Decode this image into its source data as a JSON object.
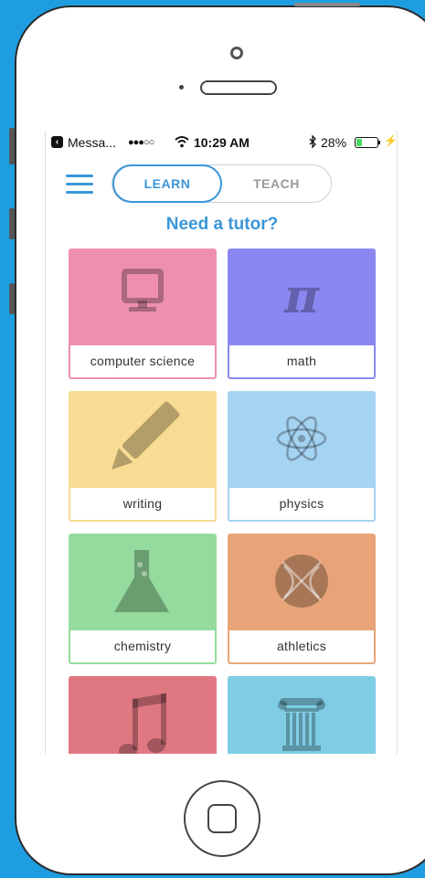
{
  "status_bar": {
    "back_app": "Messa...",
    "signal": "●●●○○",
    "time": "10:29 AM",
    "battery_percent": "28%",
    "battery_level": 0.28
  },
  "header": {
    "tabs": [
      {
        "label": "LEARN",
        "selected": true
      },
      {
        "label": "TEACH",
        "selected": false
      }
    ],
    "heading": "Need a tutor?"
  },
  "subjects": [
    {
      "label": "computer science",
      "icon": "computer-icon",
      "color": "#ee8fb1"
    },
    {
      "label": "math",
      "icon": "pi-icon",
      "color": "#8a87f0"
    },
    {
      "label": "writing",
      "icon": "pencil-icon",
      "color": "#f8dc93"
    },
    {
      "label": "physics",
      "icon": "atom-icon",
      "color": "#a5d3f2"
    },
    {
      "label": "chemistry",
      "icon": "flask-icon",
      "color": "#94db9d"
    },
    {
      "label": "athletics",
      "icon": "basketball-icon",
      "color": "#e8a478"
    },
    {
      "label": "",
      "icon": "music-note-icon",
      "color": "#e07881"
    },
    {
      "label": "",
      "icon": "column-icon",
      "color": "#7fcde4"
    }
  ]
}
